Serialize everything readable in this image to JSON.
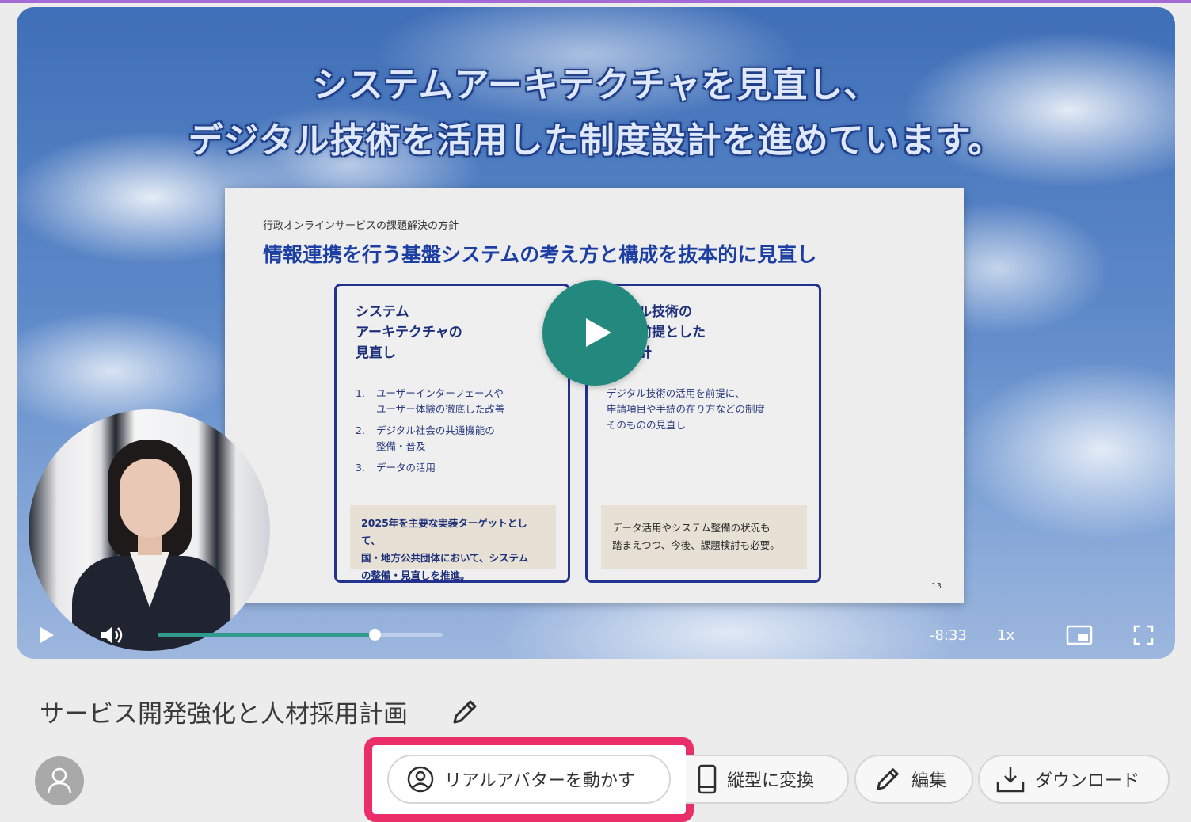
{
  "player": {
    "headline_line1": "システムアーキテクチャを見直し、",
    "headline_line2": "デジタル技術を活用した制度設計を進めています。",
    "slide": {
      "kicker": "行政オンラインサービスの課題解決の方針",
      "title": "情報連携を行う基盤システムの考え方と構成を抜本的に見直し",
      "left_card": {
        "heading_lines": [
          "システム",
          "アーキテクチャの",
          "見直し"
        ],
        "items": [
          {
            "num": "1.",
            "text_lines": [
              "ユーザーインターフェースや",
              "ユーザー体験の徹底した改善"
            ]
          },
          {
            "num": "2.",
            "text_lines": [
              "デジタル社会の共通機能の",
              "整備・普及"
            ]
          },
          {
            "num": "3.",
            "text_lines": [
              "データの活用"
            ]
          }
        ],
        "note_lines": [
          "2025年を主要な実装ターゲットとして、",
          "国・地方公共団体において、システム",
          "の整備・見直しを推進。"
        ]
      },
      "right_card": {
        "heading_lines": [
          "ル技術の",
          "前提とした",
          "計"
        ],
        "desc_lines": [
          "デジタル技術の活用を前提に、",
          "申請項目や手続の在り方などの制度",
          "そのものの見直し"
        ],
        "note_lines": [
          "データ活用やシステム整備の状況も",
          "踏まえつつ、今後、課題検討も必要。"
        ]
      },
      "page_number": "13"
    },
    "controls": {
      "progress_fraction": 0.76,
      "time_remaining": "-8:33",
      "speed": "1x"
    },
    "icons": {
      "big_play": "play-icon",
      "play": "play-icon",
      "volume": "volume-icon",
      "pip": "picture-in-picture-icon",
      "fullscreen": "fullscreen-icon"
    },
    "colors": {
      "play_button": "#23897e",
      "progress": "#2f9a8d"
    }
  },
  "video": {
    "title": "サービス開発強化と人材採用計画"
  },
  "actions": {
    "avatar_button": "リアルアバターを動かす",
    "vertical_button": "縦型に変換",
    "edit_button": "編集",
    "download_button": "ダウンロード"
  },
  "colors": {
    "highlight_border": "#ea2e68",
    "top_strip": "#a46ad6"
  }
}
